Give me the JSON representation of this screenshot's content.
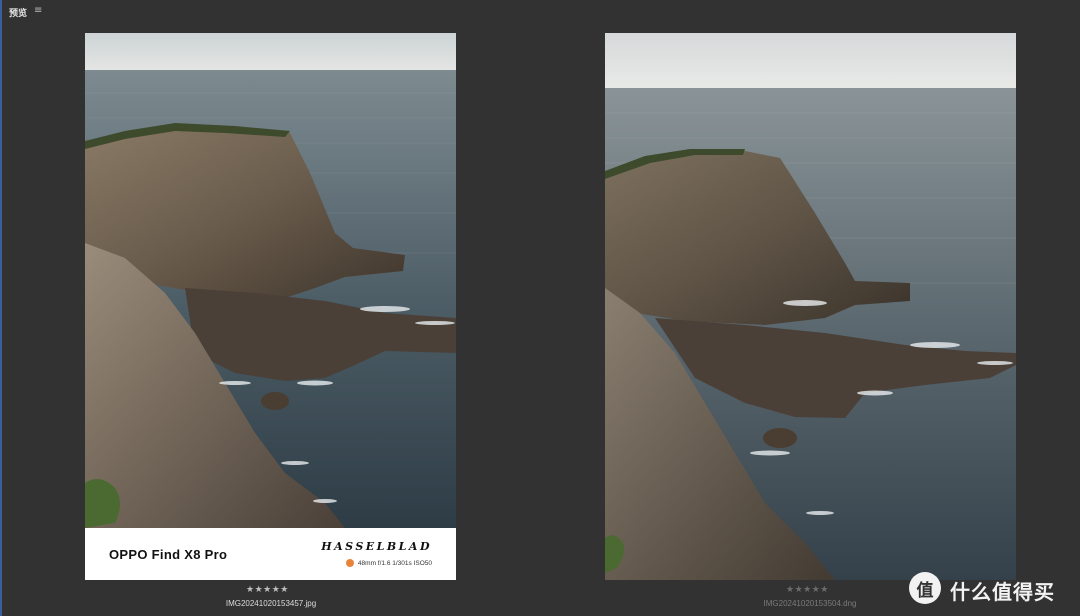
{
  "header": {
    "panel_title": "预览",
    "menu_icon": "≡"
  },
  "photos": {
    "left": {
      "device": "OPPO Find X8 Pro",
      "brand": "HASSELBLAD",
      "exif": "48mm f/1.6 1/301s ISO50",
      "rating": "★★★★★",
      "filename": "IMG20241020153457.jpg"
    },
    "right": {
      "rating": "★★★★★",
      "filename": "IMG20241020153504.dng"
    }
  },
  "site": {
    "logo_glyph": "值",
    "name": "什么值得买"
  },
  "colors": {
    "background": "#323232",
    "lens_dot": "#e8833a",
    "selection_edge": "#3a5f9c"
  }
}
